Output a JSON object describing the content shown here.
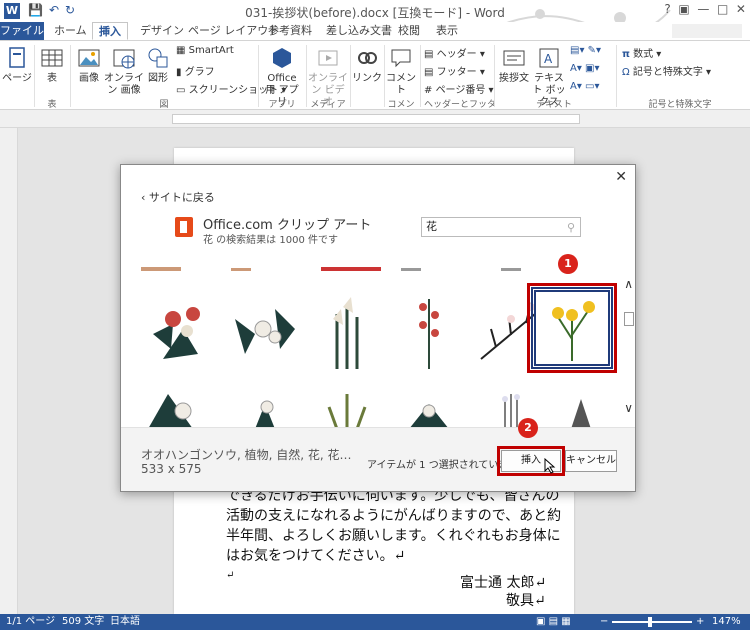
{
  "window": {
    "title": "031-挨拶状(before).docx [互換モード] - Word",
    "app_icon": "W",
    "controls": [
      "?",
      "▣",
      "—",
      "□",
      "✕"
    ]
  },
  "tabs": {
    "file": "ファイル",
    "home": "ホーム",
    "insert": "挿入",
    "design": "デザイン",
    "layout": "ページ レイアウト",
    "references": "参考資料",
    "mailings": "差し込み文書",
    "review": "校閲",
    "view": "表示"
  },
  "ribbon": {
    "page": "ページ",
    "table": "表",
    "picture": "画像",
    "online_picture": "オンライン 画像",
    "shapes": "図形",
    "smartart": "SmartArt",
    "chart": "グラフ",
    "screenshot": "スクリーンショット",
    "office_apps": "Office 用 アプリ",
    "online_video": "オンライン ビデオ",
    "link": "リンク",
    "comment": "コメント",
    "header": "ヘッダー",
    "footer": "フッター",
    "page_number": "ページ番号",
    "greeting": "挨拶文",
    "textbox": "テキスト ボックス",
    "equation": "数式",
    "symbol": "記号と特殊文字",
    "groups": {
      "table": "表",
      "illustrations": "図",
      "apps": "アプリ",
      "media": "メディア",
      "comments": "コメント",
      "header_footer": "ヘッダーとフッター",
      "text": "テキスト",
      "symbols": "記号と特殊文字"
    }
  },
  "dialog": {
    "back": "‹ サイトに戻る",
    "title": "Office.com クリップ アート",
    "subtitle": "花 の検索結果は 1000 件です",
    "search_value": "花",
    "search_icon": "⚲",
    "close": "✕",
    "selected_item_keywords": "オオハンゴンソウ, 植物, 自然, 花, 花…",
    "selected_item_size": "533 x 575",
    "selection_status": "アイテムが 1 つ選択されています。",
    "insert_button": "挿入",
    "cancel_button": "キャンセル"
  },
  "markers": [
    "1",
    "2"
  ],
  "document": {
    "lines": [
      "できるだけお手伝いに伺います。少しでも、皆さんの",
      "活動の支えになれるようにがんばりますので、あと約",
      "半年間、よろしくお願いします。くれぐれもお身体に",
      "はお気をつけてください。↵"
    ],
    "blank_mark": "↵",
    "signature_name": "富士通 太郎↵",
    "closing": "敬具↵"
  },
  "status_bar": {
    "page": "1/1 ページ",
    "words": "509 文字",
    "language": "日本語",
    "zoom": "147%"
  },
  "colors": {
    "word_blue": "#2b579a",
    "highlight_red": "#c00000"
  }
}
